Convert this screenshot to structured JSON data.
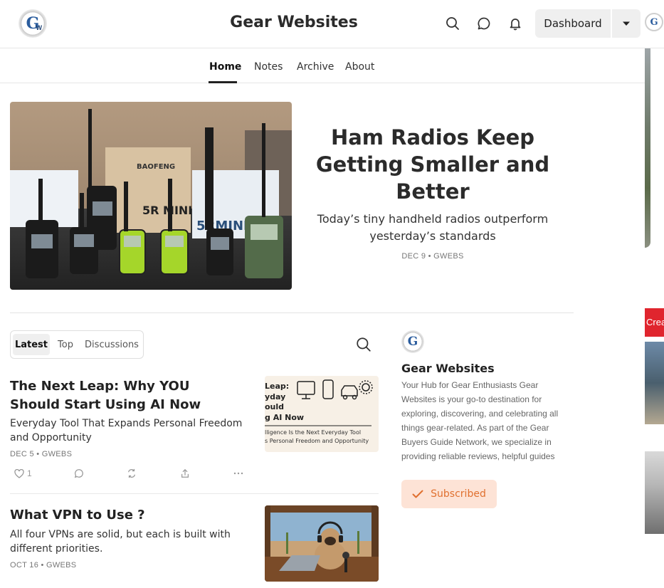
{
  "header": {
    "site_title": "Gear Websites",
    "logo_letter": "G",
    "logo_sub": "W",
    "dashboard_label": "Dashboard",
    "icons": [
      "search-icon",
      "chat-icon",
      "bell-icon",
      "chevron-down-icon"
    ]
  },
  "nav": {
    "items": [
      "Home",
      "Notes",
      "Archive",
      "About"
    ],
    "active": "Home"
  },
  "edge": {
    "red_badge": "Crea"
  },
  "hero": {
    "title": "Ham Radios Keep Getting Smaller and Better",
    "subtitle": "Today’s tiny handheld radios outperform yesterday’s standards",
    "meta": "DEC 9 • GWEBS",
    "image_labels": {
      "box1": "BAOFENG",
      "box2": "5R MINI",
      "box3": "5RMINI"
    }
  },
  "feed": {
    "tabs": [
      "Latest",
      "Top",
      "Discussions"
    ],
    "active_tab": "Latest",
    "posts": [
      {
        "title": "The Next Leap: Why YOU Should Start Using AI Now",
        "subtitle": "Everyday Tool That Expands Personal Freedom and Opportunity",
        "meta": "DEC 5 • GWEBS",
        "likes": "1",
        "thumb_lines": [
          "Leap:",
          "yday",
          "ould",
          "g AI Now"
        ],
        "thumb_caption": [
          "lligence Is the Next Everyday Tool",
          "s Personal Freedom and Opportunity"
        ]
      },
      {
        "title": "What VPN to Use ?",
        "subtitle": "All four VPNs are solid, but each is built with different priorities.",
        "meta": "OCT 16 • GWEBS"
      }
    ]
  },
  "sidebar": {
    "name": "Gear Websites",
    "description": "Your Hub for Gear Enthusiasts Gear Websites is your go-to destination for exploring, discovering, and celebrating all things gear-related. As part of the Gear Buyers Guide Network, we specialize in providing reliable reviews, helpful guides",
    "subscribed_label": "Subscribed"
  },
  "colors": {
    "accent": "#e0702f",
    "subscribed_bg": "#fde3d6",
    "logo_blue": "#2b5d9e"
  }
}
